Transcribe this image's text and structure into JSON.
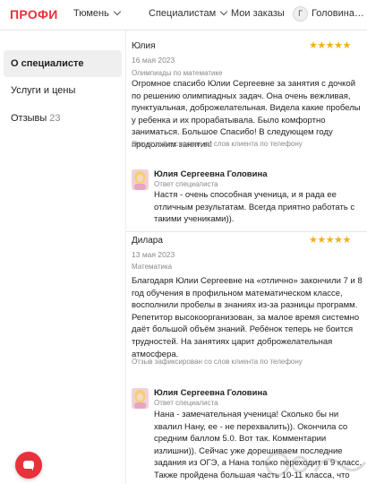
{
  "header": {
    "logo": "ПРОФИ",
    "city": "Тюмень",
    "specialists": "Специалистам",
    "orders": "Мои заказы",
    "avatar_initial": "Г",
    "user_name": "Головина…"
  },
  "sidebar": {
    "items": [
      {
        "label": "О специалисте"
      },
      {
        "label": "Услуги и цены"
      },
      {
        "label": "Отзывы",
        "count": "23"
      }
    ]
  },
  "reviews": [
    {
      "author": "Юлия",
      "rating": 5,
      "date": "16 мая 2023",
      "category": "Олимпиады по математике",
      "text": "Огромное спасибо Юлии Сергеевне за занятия с дочкой по решению олимпиадных задач. Она очень вежливая, пунктуальная, доброжелательная. Видела какие пробелы у ребенка и их прорабатывала. Было комфортно заниматься. Большое Спасибо! В следующем году продолжим занятия!",
      "note": "Отзыв зафиксирован со слов клиента по телефону",
      "answer": {
        "name": "Юлия Сергеевна Головина",
        "role": "Ответ специалиста",
        "text": "Настя - очень способная ученица, и я рада ее отличным результатам. Всегда приятно работать с такими учениками))."
      }
    },
    {
      "author": "Дилара",
      "rating": 5,
      "date": "13 мая 2023",
      "category": "Математика",
      "text": "Благодаря Юлии Сергеевне на «отлично» закончили 7 и 8 год обучения в профильном математическом классе, восполнили пробелы в знаниях из-за разницы программ. Репетитор высокоорганизован, за малое время системно даёт большой объём знаний. Ребёнок теперь не боится трудностей. На занятиях царит доброжелательная атмосфера.",
      "note": "Отзыв зафиксирован со слов клиента по телефону",
      "answer": {
        "name": "Юлия Сергеевна Головина",
        "role": "Ответ специалиста",
        "text": "Нана - замечательная ученица! Сколько бы ни хвалил Нану, ее - не перехвалить)). Окончила со средним баллом 5.0. Вот так. Комментарии излишни)). Сейчас уже дорешиваем последние задания из ОГЭ, а Нана только переходит в 9 класс. Также пройдена большая часть 10-11 класса, что еще добавить? Нану - на доску почета!"
      }
    }
  ],
  "colors": {
    "brand": "#e8313a",
    "star": "#f2b01e",
    "muted": "#8a8a8a"
  },
  "icons": {
    "chevron": "chevron-down-icon",
    "chat": "chat-icon",
    "star": "star-icon"
  }
}
